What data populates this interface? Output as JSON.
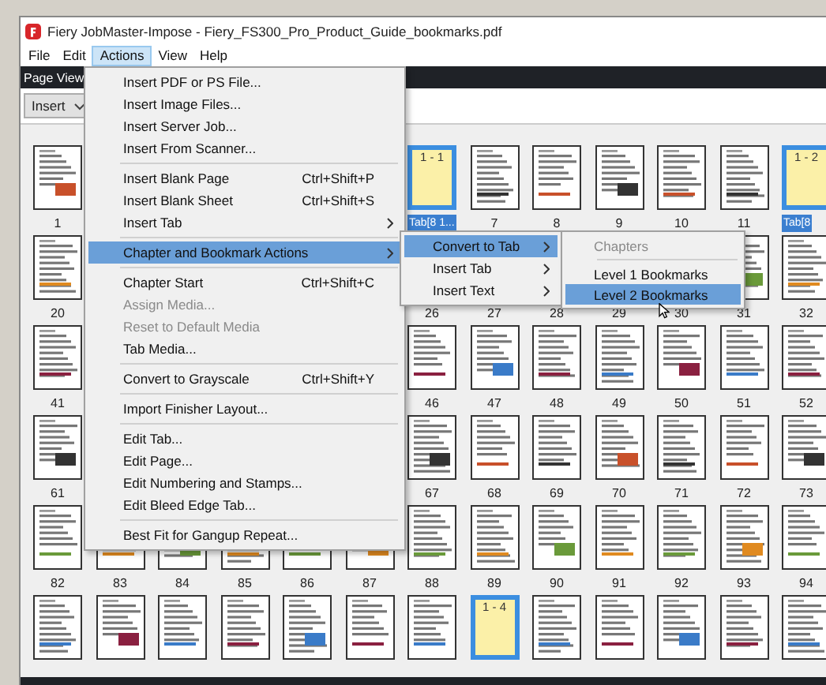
{
  "window": {
    "title": "Fiery JobMaster-Impose - Fiery_FS300_Pro_Product_Guide_bookmarks.pdf"
  },
  "menu_bar": [
    {
      "label": "File",
      "selected": false
    },
    {
      "label": "Edit",
      "selected": false
    },
    {
      "label": "Actions",
      "selected": true
    },
    {
      "label": "View",
      "selected": false
    },
    {
      "label": "Help",
      "selected": false
    }
  ],
  "panel_title": "Page View",
  "toolbar": {
    "dropdown": "Insert"
  },
  "actions_menu": [
    {
      "kind": "item",
      "label": "Insert PDF or PS File...",
      "submenu": false,
      "disabled": false,
      "selected": false
    },
    {
      "kind": "item",
      "label": "Insert Image Files...",
      "submenu": false,
      "disabled": false,
      "selected": false
    },
    {
      "kind": "item",
      "label": "Insert Server Job...",
      "submenu": false,
      "disabled": false,
      "selected": false
    },
    {
      "kind": "item",
      "label": "Insert From Scanner...",
      "submenu": false,
      "disabled": false,
      "selected": false
    },
    {
      "kind": "separator"
    },
    {
      "kind": "item",
      "label": "Insert Blank Page",
      "shortcut": "Ctrl+Shift+P",
      "submenu": false,
      "disabled": false,
      "selected": false
    },
    {
      "kind": "item",
      "label": "Insert Blank Sheet",
      "shortcut": "Ctrl+Shift+S",
      "submenu": false,
      "disabled": false,
      "selected": false
    },
    {
      "kind": "item",
      "label": "Insert Tab",
      "submenu": true,
      "disabled": false,
      "selected": false
    },
    {
      "kind": "separator"
    },
    {
      "kind": "item",
      "label": "Chapter and Bookmark Actions",
      "submenu": true,
      "disabled": false,
      "selected": true
    },
    {
      "kind": "separator"
    },
    {
      "kind": "item",
      "label": "Chapter Start",
      "shortcut": "Ctrl+Shift+C",
      "submenu": false,
      "disabled": false,
      "selected": false
    },
    {
      "kind": "item",
      "label": "Assign Media...",
      "submenu": false,
      "disabled": true,
      "selected": false
    },
    {
      "kind": "item",
      "label": "Reset to Default Media",
      "submenu": false,
      "disabled": true,
      "selected": false
    },
    {
      "kind": "item",
      "label": "Tab Media...",
      "submenu": false,
      "disabled": false,
      "selected": false
    },
    {
      "kind": "separator"
    },
    {
      "kind": "item",
      "label": "Convert to Grayscale",
      "shortcut": "Ctrl+Shift+Y",
      "submenu": false,
      "disabled": false,
      "selected": false
    },
    {
      "kind": "separator"
    },
    {
      "kind": "item",
      "label": "Import Finisher Layout...",
      "submenu": false,
      "disabled": false,
      "selected": false
    },
    {
      "kind": "separator"
    },
    {
      "kind": "item",
      "label": "Edit Tab...",
      "submenu": false,
      "disabled": false,
      "selected": false
    },
    {
      "kind": "item",
      "label": "Edit Page...",
      "submenu": false,
      "disabled": false,
      "selected": false
    },
    {
      "kind": "item",
      "label": "Edit Numbering and Stamps...",
      "submenu": false,
      "disabled": false,
      "selected": false
    },
    {
      "kind": "item",
      "label": "Edit Bleed Edge Tab...",
      "submenu": false,
      "disabled": false,
      "selected": false
    },
    {
      "kind": "separator"
    },
    {
      "kind": "item",
      "label": "Best Fit for Gangup Repeat...",
      "submenu": false,
      "disabled": false,
      "selected": false
    }
  ],
  "chapter_submenu": [
    {
      "kind": "item",
      "label": "Convert to Tab",
      "submenu": true,
      "disabled": false,
      "selected": true
    },
    {
      "kind": "item",
      "label": "Insert Tab",
      "submenu": true,
      "disabled": false,
      "selected": false
    },
    {
      "kind": "item",
      "label": "Insert Text",
      "submenu": true,
      "disabled": false,
      "selected": false
    }
  ],
  "convert_submenu": [
    {
      "kind": "item",
      "label": "Chapters",
      "submenu": false,
      "disabled": true,
      "selected": false
    },
    {
      "kind": "separator"
    },
    {
      "kind": "item",
      "label": "Level 1 Bookmarks",
      "submenu": false,
      "disabled": false,
      "selected": false
    },
    {
      "kind": "item",
      "label": "Level 2 Bookmarks",
      "submenu": false,
      "disabled": false,
      "selected": true
    }
  ],
  "thumbnail_rows": [
    [
      {
        "kind": "page",
        "label": "1"
      },
      {
        "kind": "hidden"
      },
      {
        "kind": "hidden"
      },
      {
        "kind": "hidden"
      },
      {
        "kind": "hidden"
      },
      {
        "kind": "hidden"
      },
      {
        "kind": "tab",
        "title": "1 - 1",
        "label": "Tab[8 1...",
        "selected": true
      },
      {
        "kind": "page",
        "label": "7"
      },
      {
        "kind": "page",
        "label": "8"
      },
      {
        "kind": "page",
        "label": "9"
      },
      {
        "kind": "page",
        "label": "10"
      },
      {
        "kind": "page",
        "label": "11"
      },
      {
        "kind": "tab",
        "title": "1 - 2",
        "label": "Tab[8",
        "selected": true
      }
    ],
    [
      {
        "kind": "page",
        "label": "20"
      },
      {
        "kind": "hidden"
      },
      {
        "kind": "hidden"
      },
      {
        "kind": "hidden"
      },
      {
        "kind": "hidden"
      },
      {
        "kind": "hidden"
      },
      {
        "kind": "covered",
        "label": "26"
      },
      {
        "kind": "covered",
        "label": "27"
      },
      {
        "kind": "covered",
        "label": "28"
      },
      {
        "kind": "covered",
        "label": "29"
      },
      {
        "kind": "covered",
        "label": "30"
      },
      {
        "kind": "page",
        "label": "31"
      },
      {
        "kind": "page",
        "label": "32"
      }
    ],
    [
      {
        "kind": "page",
        "label": "41"
      },
      {
        "kind": "hidden"
      },
      {
        "kind": "hidden"
      },
      {
        "kind": "hidden"
      },
      {
        "kind": "hidden"
      },
      {
        "kind": "hidden"
      },
      {
        "kind": "page",
        "label": "46"
      },
      {
        "kind": "page",
        "label": "47"
      },
      {
        "kind": "page",
        "label": "48"
      },
      {
        "kind": "page",
        "label": "49"
      },
      {
        "kind": "page",
        "label": "50"
      },
      {
        "kind": "page",
        "label": "51"
      },
      {
        "kind": "page",
        "label": "52"
      }
    ],
    [
      {
        "kind": "page",
        "label": "61"
      },
      {
        "kind": "hidden"
      },
      {
        "kind": "hidden"
      },
      {
        "kind": "hidden"
      },
      {
        "kind": "hidden"
      },
      {
        "kind": "hidden"
      },
      {
        "kind": "page",
        "label": "67"
      },
      {
        "kind": "page",
        "label": "68"
      },
      {
        "kind": "page",
        "label": "69"
      },
      {
        "kind": "page",
        "label": "70"
      },
      {
        "kind": "page",
        "label": "71"
      },
      {
        "kind": "page",
        "label": "72"
      },
      {
        "kind": "page",
        "label": "73"
      }
    ],
    [
      {
        "kind": "page",
        "label": "82"
      },
      {
        "kind": "page",
        "label": "83"
      },
      {
        "kind": "page",
        "label": "84"
      },
      {
        "kind": "page",
        "label": "85"
      },
      {
        "kind": "page",
        "label": "86"
      },
      {
        "kind": "page",
        "label": "87"
      },
      {
        "kind": "page",
        "label": "88"
      },
      {
        "kind": "page",
        "label": "89"
      },
      {
        "kind": "page",
        "label": "90"
      },
      {
        "kind": "page",
        "label": "91"
      },
      {
        "kind": "page",
        "label": "92"
      },
      {
        "kind": "page",
        "label": "93"
      },
      {
        "kind": "page",
        "label": "94"
      }
    ],
    [
      {
        "kind": "page"
      },
      {
        "kind": "page"
      },
      {
        "kind": "page"
      },
      {
        "kind": "page"
      },
      {
        "kind": "page"
      },
      {
        "kind": "page"
      },
      {
        "kind": "page"
      },
      {
        "kind": "tab",
        "title": "1 - 4",
        "selected": true
      },
      {
        "kind": "page"
      },
      {
        "kind": "page"
      },
      {
        "kind": "page"
      },
      {
        "kind": "page"
      },
      {
        "kind": "page"
      }
    ]
  ]
}
